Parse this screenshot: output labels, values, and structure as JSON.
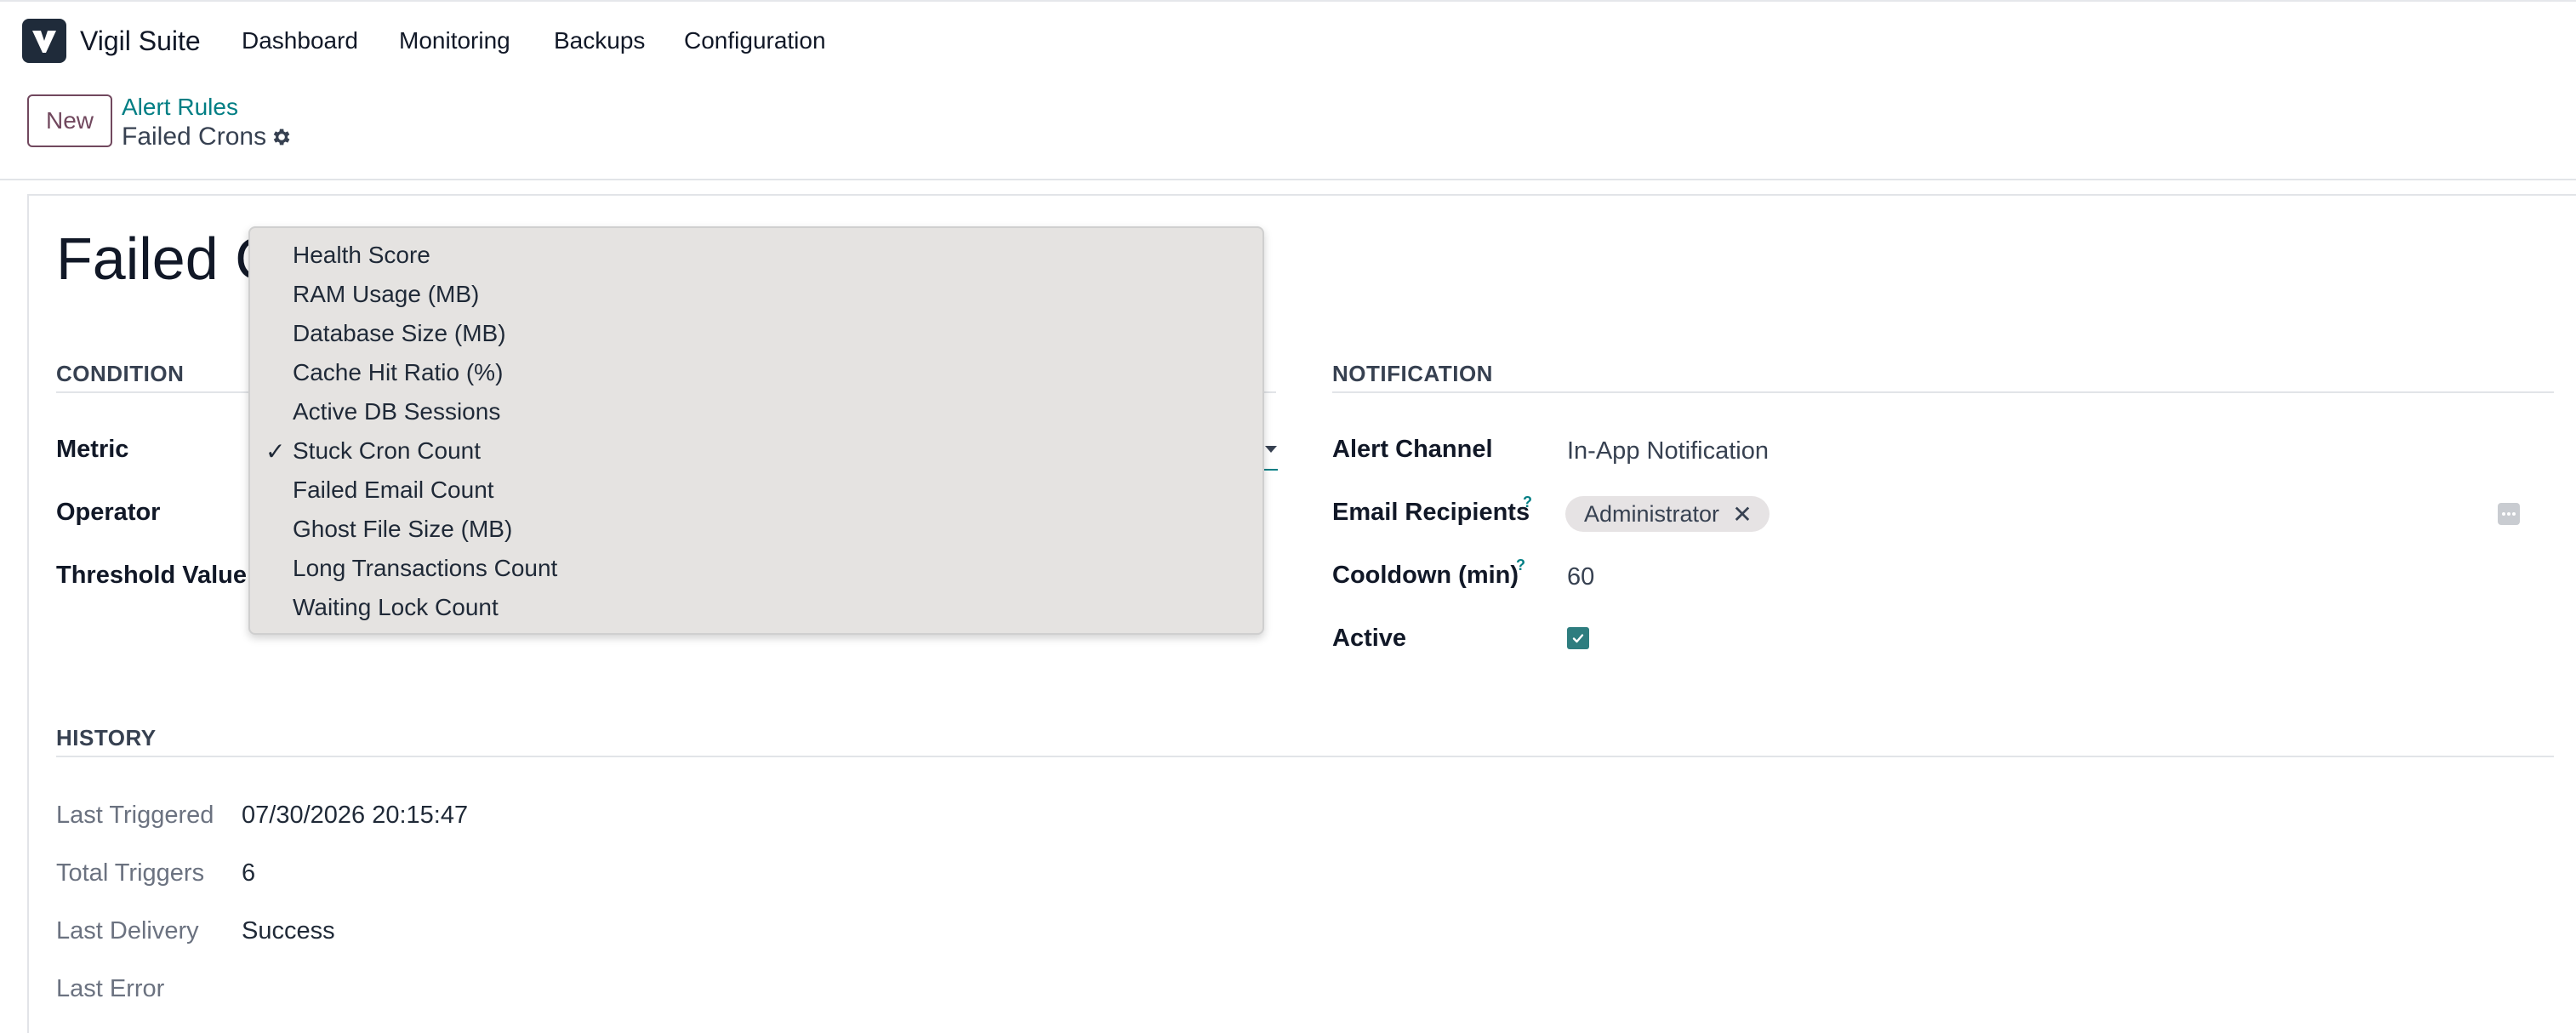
{
  "app": {
    "name": "Vigil Suite",
    "logo_icon": "vigil-logo-icon",
    "brand_color": "#1f2b3a"
  },
  "nav": {
    "items": [
      "Dashboard",
      "Monitoring",
      "Backups",
      "Configuration"
    ]
  },
  "control": {
    "new_label": "New",
    "breadcrumb_parent": "Alert Rules",
    "breadcrumb_current": "Failed Crons",
    "settings_icon": "gear-icon"
  },
  "record": {
    "title": "Failed Crons",
    "title_visible": "Failed C"
  },
  "condition": {
    "section_title": "CONDITION",
    "metric_label": "Metric",
    "operator_label": "Operator",
    "threshold_label": "Threshold Value"
  },
  "notification": {
    "section_title": "NOTIFICATION",
    "channel_label": "Alert Channel",
    "channel_value": "In-App Notification",
    "recipients_label": "Email Recipients",
    "recipients_help": "?",
    "recipients_tag": "Administrator",
    "recipients_tag_remove": "✕",
    "cooldown_label": "Cooldown (min)",
    "cooldown_help": "?",
    "cooldown_value": "60",
    "active_label": "Active",
    "active_checked": true
  },
  "history": {
    "section_title": "HISTORY",
    "last_triggered_label": "Last Triggered",
    "last_triggered_value": "07/30/2026 20:15:47",
    "total_triggers_label": "Total Triggers",
    "total_triggers_value": "6",
    "last_delivery_label": "Last Delivery",
    "last_delivery_value": "Success",
    "last_error_label": "Last Error"
  },
  "metric_dropdown": {
    "selected": "Stuck Cron Count",
    "check_mark": "✓",
    "options": [
      "Health Score",
      "RAM Usage (MB)",
      "Database Size (MB)",
      "Cache Hit Ratio (%)",
      "Active DB Sessions",
      "Stuck Cron Count",
      "Failed Email Count",
      "Ghost File Size (MB)",
      "Long Transactions Count",
      "Waiting Lock Count"
    ]
  },
  "colors": {
    "accent": "#017e84",
    "primary_button": "#71485e",
    "checkbox": "#2e7d7f",
    "dropdown_bg": "#e5e3e1"
  }
}
